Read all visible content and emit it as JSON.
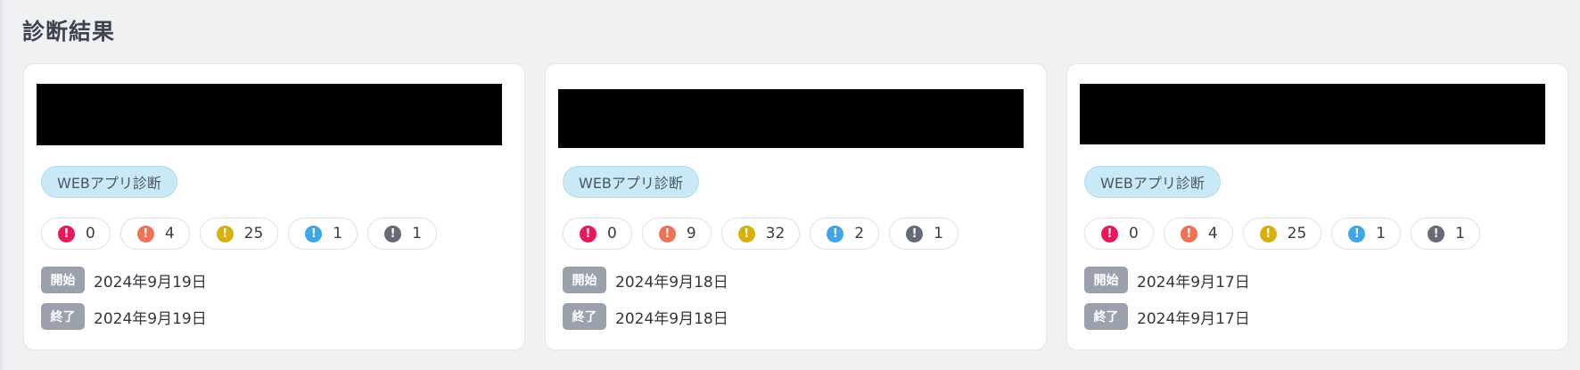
{
  "page_title": "診断結果",
  "severity_colors": {
    "critical": "#e8195a",
    "high": "#ef7257",
    "medium": "#d6b10d",
    "low": "#3fa6e8",
    "info": "#656b78"
  },
  "date_labels": {
    "start": "開始",
    "end": "終了"
  },
  "cards": [
    {
      "tag": "WEBアプリ診断",
      "counts": {
        "critical": "0",
        "high": "4",
        "medium": "25",
        "low": "1",
        "info": "1"
      },
      "start_date": "2024年9月19日",
      "end_date": "2024年9月19日"
    },
    {
      "tag": "WEBアプリ診断",
      "counts": {
        "critical": "0",
        "high": "9",
        "medium": "32",
        "low": "2",
        "info": "1"
      },
      "start_date": "2024年9月18日",
      "end_date": "2024年9月18日"
    },
    {
      "tag": "WEBアプリ診断",
      "counts": {
        "critical": "0",
        "high": "4",
        "medium": "25",
        "low": "1",
        "info": "1"
      },
      "start_date": "2024年9月17日",
      "end_date": "2024年9月17日"
    }
  ]
}
